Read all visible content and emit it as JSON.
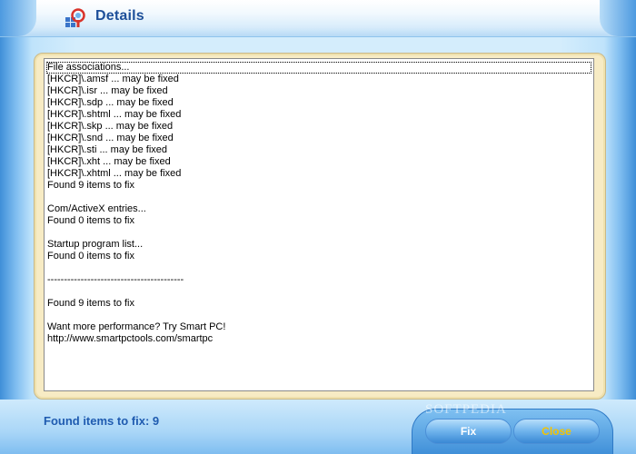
{
  "window": {
    "title": "Details",
    "icon": "tool-icon"
  },
  "log": {
    "lines": [
      "File associations...",
      "[HKCR]\\.amsf ... may be fixed",
      "[HKCR]\\.isr ... may be fixed",
      "[HKCR]\\.sdp ... may be fixed",
      "[HKCR]\\.shtml ... may be fixed",
      "[HKCR]\\.skp ... may be fixed",
      "[HKCR]\\.snd ... may be fixed",
      "[HKCR]\\.sti ... may be fixed",
      "[HKCR]\\.xht ... may be fixed",
      "[HKCR]\\.xhtml ... may be fixed",
      "Found 9 items to fix",
      "",
      "Com/ActiveX entries...",
      "Found 0 items to fix",
      "",
      "Startup program list...",
      "Found 0 items to fix",
      "",
      "-----------------------------------------",
      "",
      "Found 9 items to fix",
      "",
      "Want more performance? Try Smart PC!",
      "http://www.smartpctools.com/smartpc"
    ]
  },
  "status": {
    "text": "Found items to fix: 9"
  },
  "buttons": {
    "fix": "Fix",
    "close": "Close"
  },
  "watermark": "SOFTPEDIA",
  "colors": {
    "title_text": "#1d4f99",
    "status_text": "#1f5bb0",
    "panel_bg": "#f7ebc4",
    "close_text": "#f4c400"
  }
}
